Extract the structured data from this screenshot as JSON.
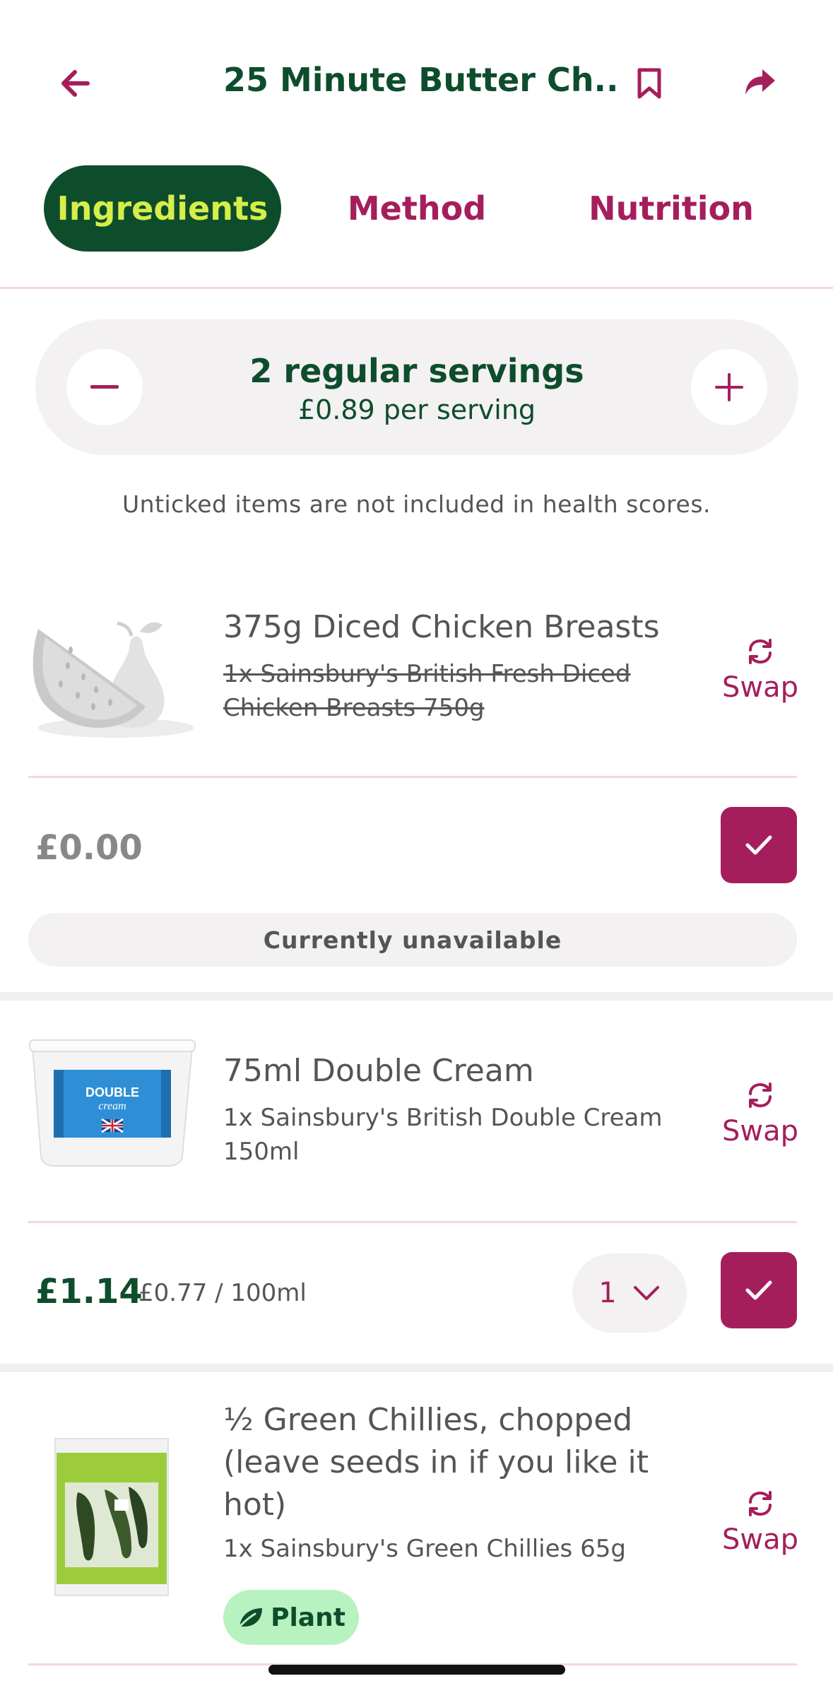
{
  "header": {
    "title": "25 Minute Butter Ch...",
    "back_icon": "arrow-left-icon",
    "bookmark_icon": "bookmark-icon",
    "share_icon": "share-arrow-icon"
  },
  "tabs": [
    {
      "label": "Ingredients",
      "active": true
    },
    {
      "label": "Method",
      "active": false
    },
    {
      "label": "Nutrition",
      "active": false
    }
  ],
  "servings": {
    "title": "2 regular servings",
    "price": "£0.89 per serving"
  },
  "note": "Unticked items are not included in health scores.",
  "items": [
    {
      "name": "375g Diced Chicken Breasts",
      "product": "1x Sainsbury's British Fresh Diced Chicken Breasts 750g",
      "product_struck": true,
      "swap_label": "Swap",
      "price": "£0.00",
      "status": "Currently unavailable",
      "checked": true
    },
    {
      "name": "75ml Double Cream",
      "product": "1x Sainsbury's British Double Cream 150ml",
      "swap_label": "Swap",
      "price": "£1.14",
      "unit_price": "£0.77 / 100ml",
      "quantity": "1",
      "checked": true
    },
    {
      "name": "½ Green Chillies, chopped (leave seeds in if you like it hot)",
      "product": "1x Sainsbury's Green Chillies 65g",
      "swap_label": "Swap",
      "badge": "Plant"
    }
  ],
  "colors": {
    "brand_green": "#0e4d2c",
    "accent_magenta": "#a51e5c",
    "lime": "#d6ee4a",
    "plant_badge": "#b8f2c0"
  }
}
